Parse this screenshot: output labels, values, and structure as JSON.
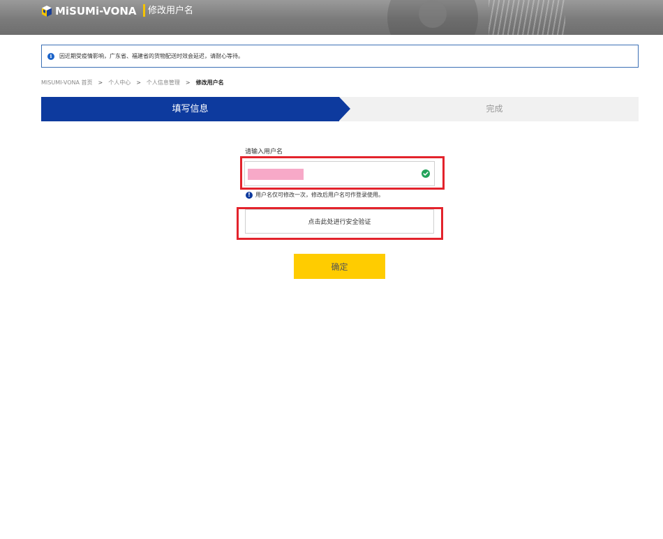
{
  "header": {
    "logo_text": "MiSUMi-VONA",
    "page_title": "修改用户名"
  },
  "notice": {
    "icon": "info-icon",
    "text": "因近期受疫情影响，广东省、福建省的货物配送时效会延迟，请耐心等待。"
  },
  "breadcrumb": {
    "items": [
      "MISUMI-VONA 首页",
      "个人中心",
      "个人信息管理"
    ],
    "current": "修改用户名",
    "separator": ">"
  },
  "steps": [
    {
      "label": "填写信息",
      "active": true
    },
    {
      "label": "完成",
      "active": false
    }
  ],
  "form": {
    "username_label": "请输入用户名",
    "username_value": "redacted",
    "hint": "用户名仅可修改一次，修改后用户名可作登录使用。",
    "verify_button": "点击此处进行安全验证",
    "confirm_button": "确定"
  },
  "colors": {
    "primary": "#0d3a9e",
    "accent": "#ffcc00",
    "highlight": "#e3232c",
    "success": "#22a35a"
  }
}
